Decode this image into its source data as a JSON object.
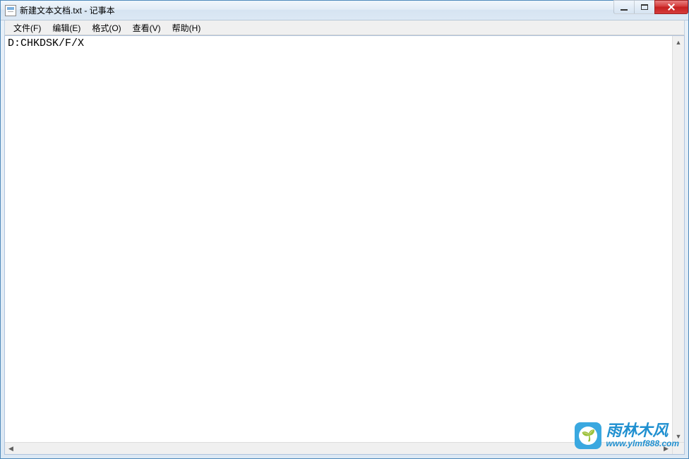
{
  "window": {
    "title": "新建文本文档.txt - 记事本"
  },
  "menu": {
    "file": "文件(F)",
    "edit": "编辑(E)",
    "format": "格式(O)",
    "view": "查看(V)",
    "help": "帮助(H)"
  },
  "editor": {
    "content": "D:CHKDSK/F/X"
  },
  "watermark": {
    "title": "雨林木风",
    "url": "www.ylmf888.com",
    "icon": "🌱"
  }
}
